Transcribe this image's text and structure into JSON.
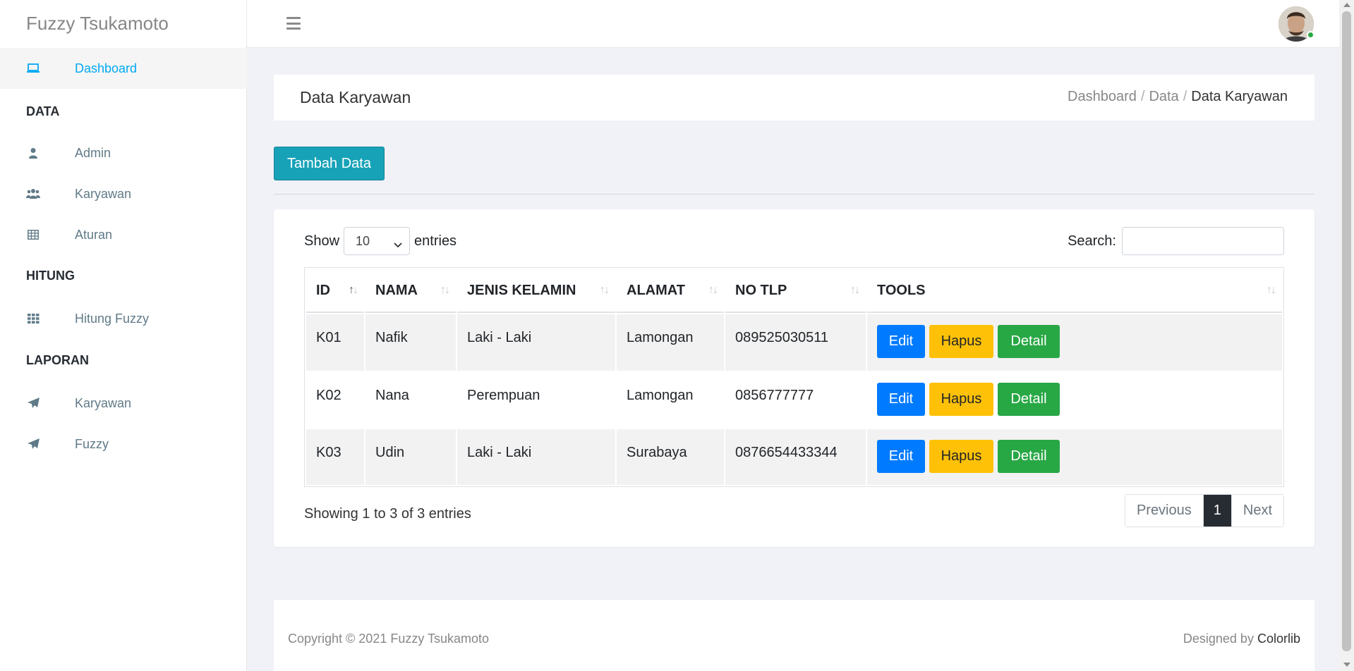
{
  "brand": "Fuzzy Tsukamoto",
  "sidebar": {
    "items": [
      {
        "type": "item",
        "label": "Dashboard",
        "icon": "laptop-icon",
        "active": true
      },
      {
        "type": "section",
        "label": "DATA"
      },
      {
        "type": "item",
        "label": "Admin",
        "icon": "user-icon"
      },
      {
        "type": "item",
        "label": "Karyawan",
        "icon": "users-icon"
      },
      {
        "type": "item",
        "label": "Aturan",
        "icon": "table-icon"
      },
      {
        "type": "section",
        "label": "HITUNG"
      },
      {
        "type": "item",
        "label": "Hitung Fuzzy",
        "icon": "grid-icon"
      },
      {
        "type": "section",
        "label": "LAPORAN"
      },
      {
        "type": "item",
        "label": "Karyawan",
        "icon": "paper-plane-icon"
      },
      {
        "type": "item",
        "label": "Fuzzy",
        "icon": "paper-plane-icon"
      }
    ]
  },
  "page": {
    "title": "Data Karyawan",
    "breadcrumb": [
      "Dashboard",
      "Data",
      "Data Karyawan"
    ],
    "breadcrumb_sep": "/"
  },
  "toolbar": {
    "add_label": "Tambah Data"
  },
  "table_controls": {
    "show_label": "Show",
    "entries_label": "entries",
    "length_value": "10",
    "search_label": "Search:"
  },
  "table": {
    "columns": [
      "ID",
      "NAMA",
      "JENIS KELAMIN",
      "ALAMAT",
      "NO TLP",
      "TOOLS"
    ],
    "rows": [
      {
        "id": "K01",
        "nama": "Nafik",
        "jk": "Laki - Laki",
        "alamat": "Lamongan",
        "tlp": "089525030511"
      },
      {
        "id": "K02",
        "nama": "Nana",
        "jk": "Perempuan",
        "alamat": "Lamongan",
        "tlp": "0856777777"
      },
      {
        "id": "K03",
        "nama": "Udin",
        "jk": "Laki - Laki",
        "alamat": "Surabaya",
        "tlp": "0876654433344"
      }
    ],
    "actions": {
      "edit": "Edit",
      "hapus": "Hapus",
      "detail": "Detail"
    }
  },
  "info_text": "Showing 1 to 3 of 3 entries",
  "pagination": {
    "previous": "Previous",
    "current": "1",
    "next": "Next"
  },
  "footer": {
    "copyright": "Copyright © 2021 Fuzzy Tsukamoto",
    "designed_by": "Designed by",
    "credit": "Colorlib"
  },
  "colors": {
    "accent": "#03a9f3",
    "add_button": "#17a2b8",
    "edit": "#007bff",
    "hapus": "#ffc107",
    "detail": "#28a745",
    "active_page": "#272c33"
  }
}
